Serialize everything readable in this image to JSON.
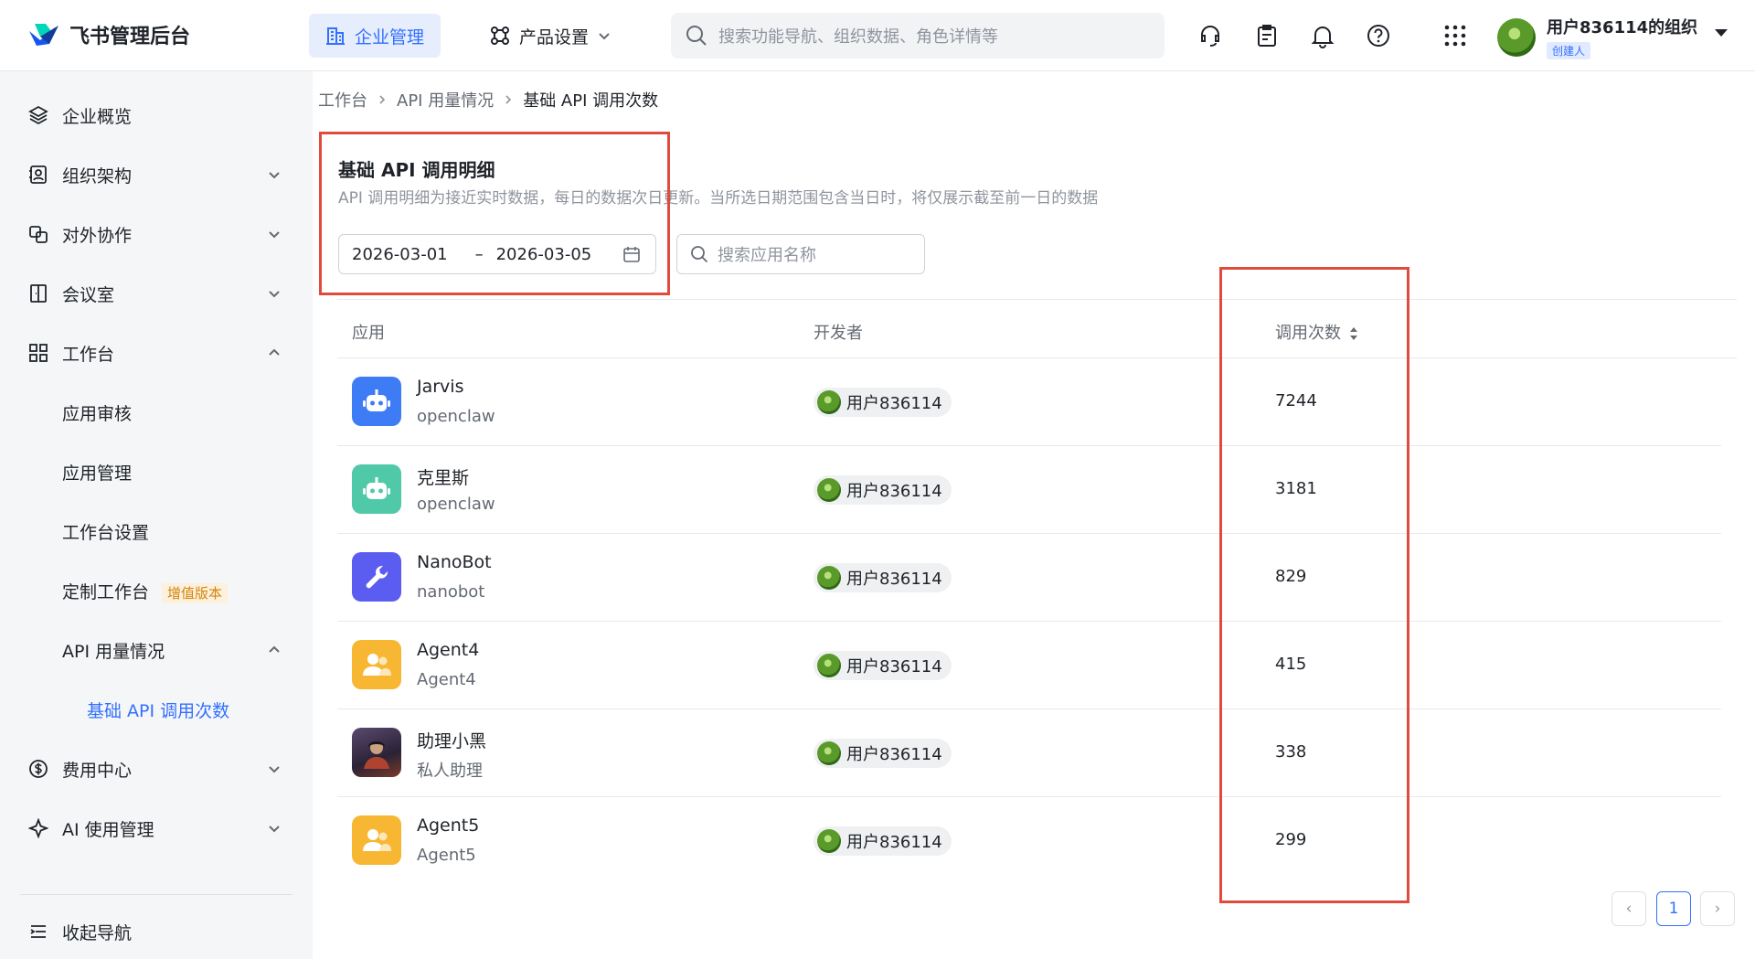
{
  "header": {
    "logo_text": "飞书管理后台",
    "nav_enterprise": "企业管理",
    "nav_product": "产品设置",
    "search_placeholder": "搜索功能导航、组织数据、角色详情等",
    "org_name": "用户836114的组织",
    "org_role": "创建人"
  },
  "sidebar": {
    "items": [
      {
        "label": "企业概览",
        "icon": "layers-icon"
      },
      {
        "label": "组织架构",
        "icon": "contacts-icon"
      },
      {
        "label": "对外协作",
        "icon": "collab-icon"
      },
      {
        "label": "会议室",
        "icon": "room-icon"
      },
      {
        "label": "工作台",
        "icon": "grid-icon"
      },
      {
        "label": "应用审核"
      },
      {
        "label": "应用管理"
      },
      {
        "label": "工作台设置"
      },
      {
        "label": "定制工作台",
        "tag": "增值版本"
      },
      {
        "label": "API 用量情况"
      },
      {
        "label": "基础 API 调用次数"
      },
      {
        "label": "费用中心",
        "icon": "dollar-icon"
      },
      {
        "label": "AI 使用管理",
        "icon": "sparkle-icon"
      }
    ],
    "collapse_label": "收起导航"
  },
  "breadcrumb": {
    "items": [
      "工作台",
      "API 用量情况",
      "基础 API 调用次数"
    ]
  },
  "card": {
    "title": "基础 API 调用明细",
    "description": "API 调用明细为接近实时数据，每日的数据次日更新。当所选日期范围包含当日时，将仅展示截至前一日的数据",
    "date_start": "2026-03-01",
    "date_sep": "–",
    "date_end": "2026-03-05",
    "search_placeholder": "搜索应用名称"
  },
  "table": {
    "columns": [
      "应用",
      "开发者",
      "调用次数"
    ],
    "rows": [
      {
        "name": "Jarvis",
        "sub": "openclaw",
        "developer": "用户836114",
        "count": "7244",
        "icon": "robot-icon",
        "color": "#3d7cf5"
      },
      {
        "name": "克里斯",
        "sub": "openclaw",
        "developer": "用户836114",
        "count": "3181",
        "icon": "robot-icon",
        "color": "#4fc9a8"
      },
      {
        "name": "NanoBot",
        "sub": "nanobot",
        "developer": "用户836114",
        "count": "829",
        "icon": "wrench-icon",
        "color": "#5b5cf0"
      },
      {
        "name": "Agent4",
        "sub": "Agent4",
        "developer": "用户836114",
        "count": "415",
        "icon": "people-icon",
        "color": "#f7b733"
      },
      {
        "name": "助理小黑",
        "sub": "私人助理",
        "developer": "用户836114",
        "count": "338",
        "icon": "portrait-icon",
        "color": "#4a3b52"
      },
      {
        "name": "Agent5",
        "sub": "Agent5",
        "developer": "用户836114",
        "count": "299",
        "icon": "people-icon",
        "color": "#f7b733"
      }
    ]
  },
  "pagination": {
    "current": "1",
    "prev": "‹",
    "next": "›"
  }
}
